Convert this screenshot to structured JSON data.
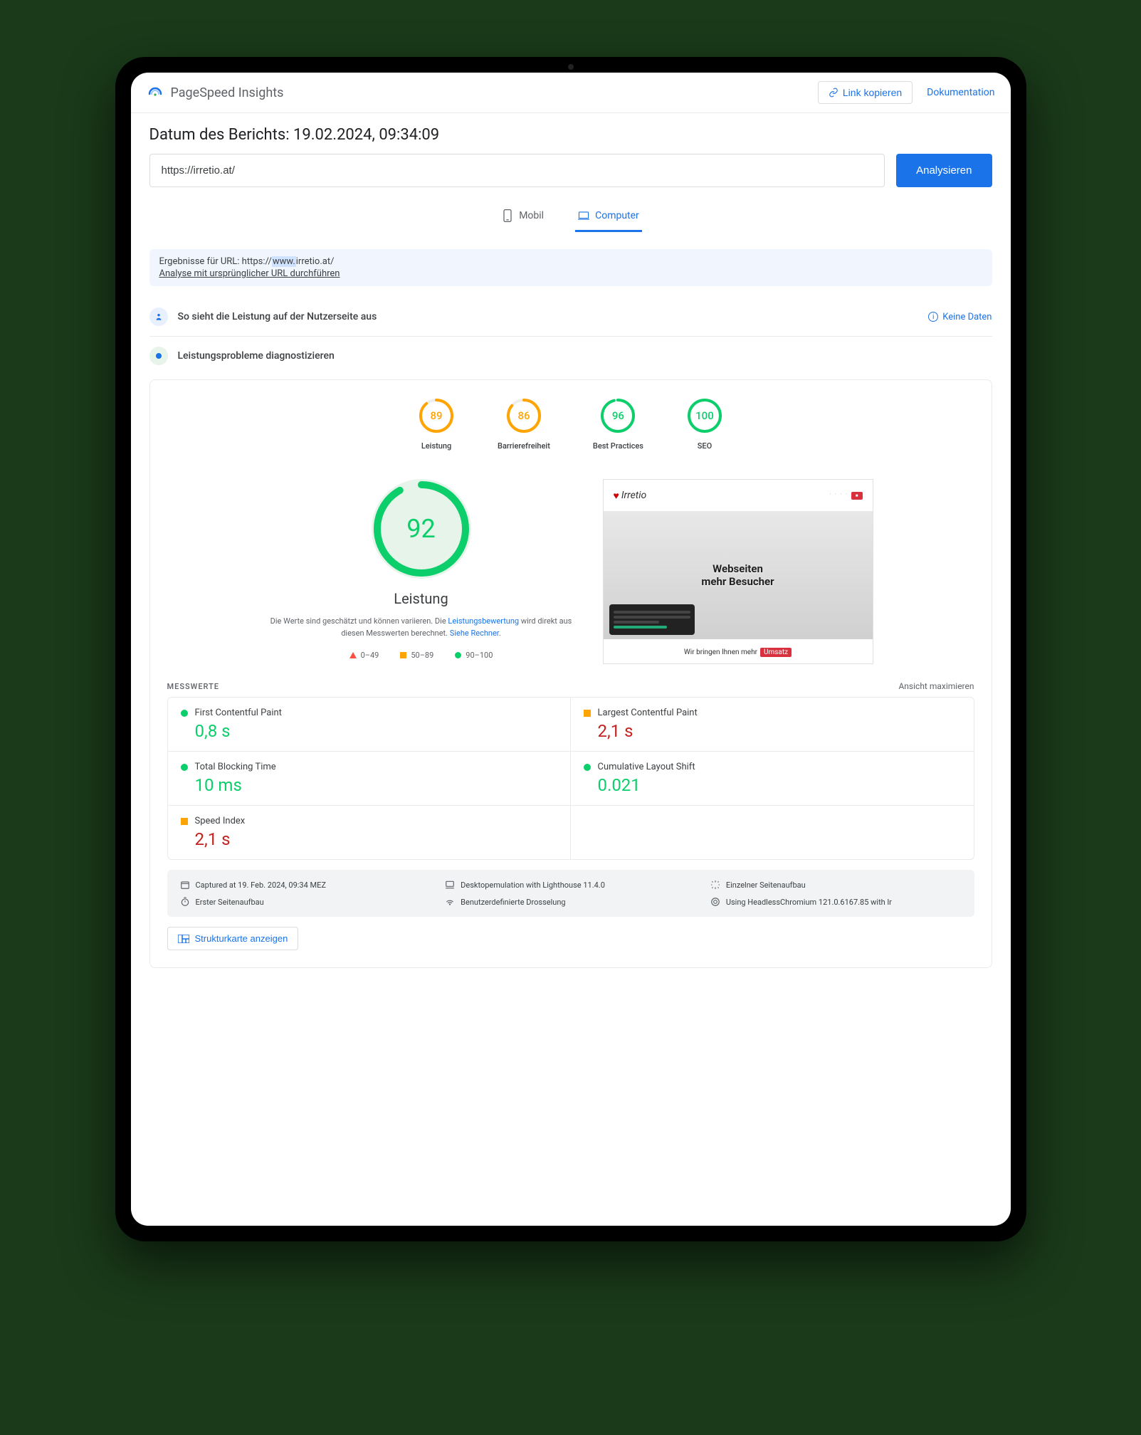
{
  "topbar": {
    "app_title": "PageSpeed Insights",
    "link_copy": "Link kopieren",
    "docs": "Dokumentation"
  },
  "report_date": "Datum des Berichts: 19.02.2024, 09:34:09",
  "url_input": "https://irretio.at/",
  "analyze_btn": "Analysieren",
  "tabs": {
    "mobile": "Mobil",
    "desktop": "Computer"
  },
  "url_results": {
    "prefix": "Ergebnisse für URL: https://",
    "www": "www.",
    "rest": "irretio.at/",
    "rerun": "Analyse mit ursprünglicher URL durchführen"
  },
  "sections": {
    "user_perf": "So sieht die Leistung auf der Nutzerseite aus",
    "no_data": "Keine Daten",
    "diagnose": "Leistungsprobleme diagnostizieren"
  },
  "scores": [
    {
      "value": "89",
      "label": "Leistung",
      "color": "#ffa400",
      "pct": 89
    },
    {
      "value": "86",
      "label": "Barrierefreiheit",
      "color": "#ffa400",
      "pct": 86
    },
    {
      "value": "96",
      "label": "Best Practices",
      "color": "#0cce6b",
      "pct": 96
    },
    {
      "value": "100",
      "label": "SEO",
      "color": "#0cce6b",
      "pct": 100
    }
  ],
  "big_score": {
    "value": "92",
    "label": "Leistung",
    "pct": 92
  },
  "perf_desc": {
    "line1": "Die Werte sind geschätzt und können variieren. Die ",
    "link1": "Leistungsbewertung",
    "line2": " wird direkt aus diesen Messwerten berechnet. ",
    "link2": "Siehe Rechner"
  },
  "legend": {
    "r": "0–49",
    "o": "50–89",
    "g": "90–100"
  },
  "screenshot": {
    "brand": "Irretio",
    "h1a": "Webseiten",
    "h1b": "mehr Besucher",
    "bar1": "Wir bringen Ihnen mehr",
    "bar2": "Umsatz"
  },
  "metrics_header": {
    "title": "MESSWERTE",
    "max": "Ansicht maximieren"
  },
  "metrics": [
    {
      "name": "First Contentful Paint",
      "value": "0,8 s",
      "status": "green"
    },
    {
      "name": "Largest Contentful Paint",
      "value": "2,1 s",
      "status": "orange"
    },
    {
      "name": "Total Blocking Time",
      "value": "10 ms",
      "status": "green"
    },
    {
      "name": "Cumulative Layout Shift",
      "value": "0.021",
      "status": "green"
    },
    {
      "name": "Speed Index",
      "value": "2,1 s",
      "status": "orange"
    }
  ],
  "footer": {
    "captured": "Captured at 19. Feb. 2024, 09:34 MEZ",
    "emulation": "Desktopemulation with Lighthouse 11.4.0",
    "single": "Einzelner Seitenaufbau",
    "initial": "Erster Seitenaufbau",
    "throttle": "Benutzerdefinierte Drosselung",
    "chrome": "Using HeadlessChromium 121.0.6167.85 with lr"
  },
  "treemap": "Strukturkarte anzeigen"
}
